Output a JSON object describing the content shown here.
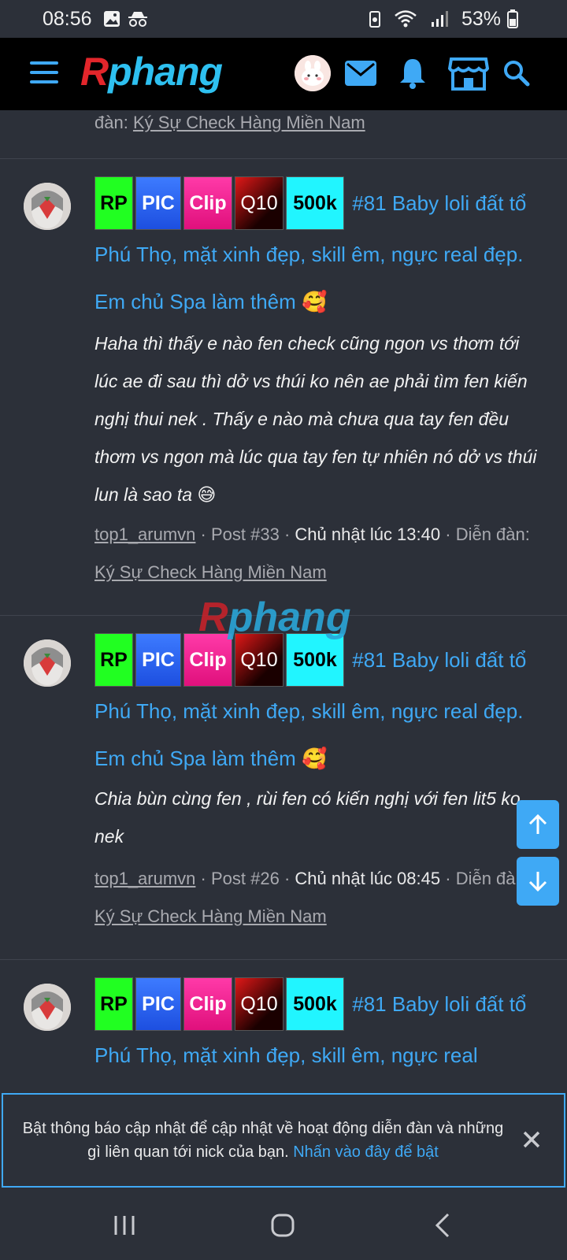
{
  "status_bar": {
    "time": "08:56",
    "battery": "53%"
  },
  "header": {
    "logo_first": "R",
    "logo_rest": "phang"
  },
  "top_post_tail": {
    "forum_label": "đàn:",
    "forum": "Ký Sự Check Hàng Miền Nam"
  },
  "posts": [
    {
      "tags": [
        "RP",
        "PIC",
        "Clip",
        "Q10",
        "500k"
      ],
      "title": "#81 Baby loli đất tổ Phú Thọ, mặt xinh đẹp, skill êm, ngực real đẹp. Em chủ Spa làm thêm 🥰",
      "excerpt": "Haha thì thấy e nào fen check cũng ngon vs thơm tới lúc ae đi sau thì dở vs thúi ko nên ae phải tìm fen kiến nghị thui nek . Thấy e nào mà chưa qua tay fen đều thơm vs ngon mà lúc qua tay fen tự nhiên nó dở vs thúi lun là sao ta 😅",
      "user": "top1_arumvn",
      "post_no": "Post #33",
      "date": "Chủ nhật lúc 13:40",
      "forum_prefix": "Diễn đàn:",
      "forum": "Ký Sự Check Hàng Miền Nam"
    },
    {
      "tags": [
        "RP",
        "PIC",
        "Clip",
        "Q10",
        "500k"
      ],
      "title": "#81 Baby loli đất tổ Phú Thọ, mặt xinh đẹp, skill êm, ngực real đẹp. Em chủ Spa làm thêm 🥰",
      "excerpt": "Chia bùn cùng fen , rùi fen có kiến nghị với fen lit5 ko nek",
      "user": "top1_arumvn",
      "post_no": "Post #26",
      "date": "Chủ nhật lúc 08:45",
      "forum_prefix": "Diễn đàn:",
      "forum": "Ký Sự Check Hàng Miền Nam"
    },
    {
      "tags": [
        "RP",
        "PIC",
        "Clip",
        "Q10",
        "500k"
      ],
      "title": "#81 Baby loli đất tổ Phú Thọ, mặt xinh đẹp, skill êm, ngực real"
    }
  ],
  "separator": "·",
  "watermark": {
    "first": "R",
    "rest": "phang"
  },
  "notice": {
    "text": "Bật thông báo cập nhật để cập nhật về hoạt động diễn đàn và những gì liên quan tới nick của bạn.",
    "link": "Nhấn vào đây để bật"
  },
  "colors": {
    "accent": "#3fa9f5",
    "background": "#2c3039",
    "header": "#000000"
  }
}
